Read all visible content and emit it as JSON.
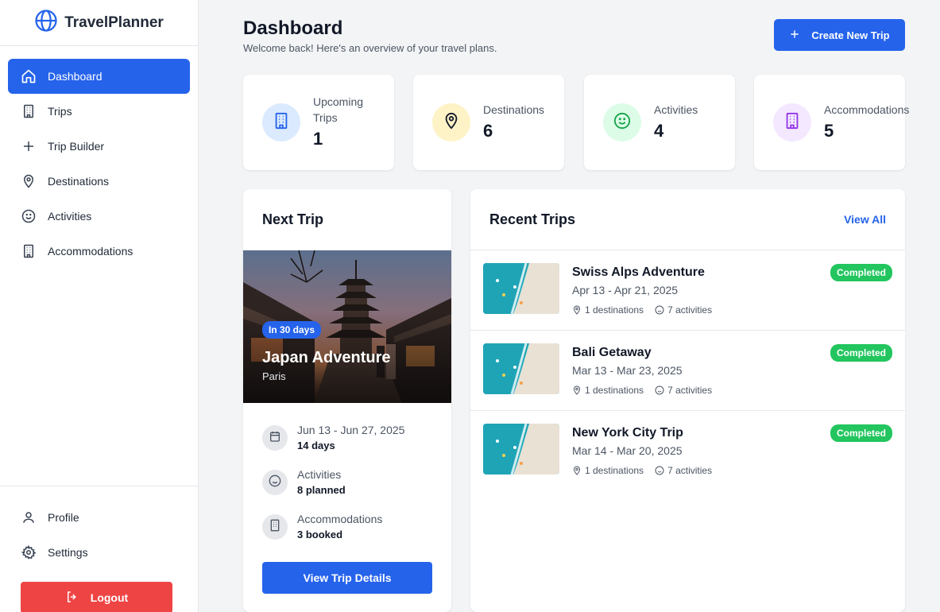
{
  "app": {
    "name": "TravelPlanner",
    "logo_icon": "globe-icon",
    "accent": "#2563eb"
  },
  "sidebar": {
    "items": [
      {
        "label": "Dashboard",
        "icon": "home-icon",
        "active": true
      },
      {
        "label": "Trips",
        "icon": "building-icon"
      },
      {
        "label": "Trip Builder",
        "icon": "plus-icon"
      },
      {
        "label": "Destinations",
        "icon": "map-pin-icon"
      },
      {
        "label": "Activities",
        "icon": "smile-icon"
      },
      {
        "label": "Accommodations",
        "icon": "building-icon"
      }
    ],
    "bottom_items": [
      {
        "label": "Profile",
        "icon": "user-icon"
      },
      {
        "label": "Settings",
        "icon": "gear-icon"
      }
    ],
    "logout_label": "Logout"
  },
  "header": {
    "title": "Dashboard",
    "subtitle": "Welcome back! Here's an overview of your travel plans.",
    "create_label": "Create New Trip"
  },
  "stats": [
    {
      "label": "Upcoming Trips",
      "value": "1",
      "icon": "building-icon",
      "color": "#dbeafe",
      "icon_color": "#2563eb"
    },
    {
      "label": "Destinations",
      "value": "6",
      "icon": "map-pin-icon",
      "color": "#fef3c7",
      "icon_color": "#111827"
    },
    {
      "label": "Activities",
      "value": "4",
      "icon": "smile-icon",
      "color": "#dcfce7",
      "icon_color": "#16a34a"
    },
    {
      "label": "Accommodations",
      "value": "5",
      "icon": "building-icon",
      "color": "#f3e8ff",
      "icon_color": "#9333ea"
    }
  ],
  "next_trip": {
    "title": "Next Trip",
    "badge": "In 30 days",
    "name": "Japan Adventure",
    "location": "Paris",
    "details": [
      {
        "label": "Jun 13 - Jun 27, 2025",
        "value": "14 days",
        "icon": "calendar-icon"
      },
      {
        "label": "Activities",
        "value": "8 planned",
        "icon": "smile-icon"
      },
      {
        "label": "Accommodations",
        "value": "3 booked",
        "icon": "building-icon"
      }
    ],
    "button_label": "View Trip Details"
  },
  "recent_trips": {
    "title": "Recent Trips",
    "view_all_label": "View All",
    "items": [
      {
        "name": "Swiss Alps Adventure",
        "dates": "Apr 13 - Apr 21, 2025",
        "destinations": "1 destinations",
        "activities": "7 activities",
        "status": "Completed"
      },
      {
        "name": "Bali Getaway",
        "dates": "Mar 13 - Mar 23, 2025",
        "destinations": "1 destinations",
        "activities": "7 activities",
        "status": "Completed"
      },
      {
        "name": "New York City Trip",
        "dates": "Mar 14 - Mar 20, 2025",
        "destinations": "1 destinations",
        "activities": "7 activities",
        "status": "Completed"
      }
    ]
  }
}
